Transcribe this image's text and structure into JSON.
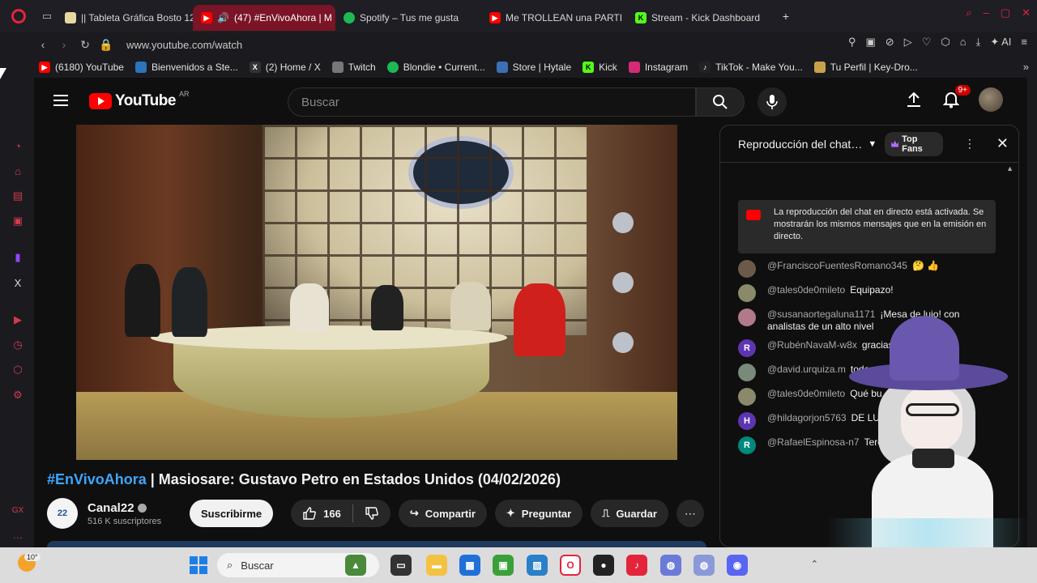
{
  "browser": {
    "tabs": [
      {
        "label": "|| Tableta Gráfica Bosto 12",
        "color": "#e6d8a0",
        "active": false
      },
      {
        "label": "(47) #EnVivoAhora | M",
        "color": "#ff0000",
        "active": true
      },
      {
        "label": "Spotify – Tus me gusta",
        "color": "#1db954",
        "active": false
      },
      {
        "label": "Me TROLLEAN una PARTI",
        "color": "#ff0000",
        "active": false
      },
      {
        "label": "Stream - Kick Dashboard",
        "color": "#53fc18",
        "active": false
      }
    ],
    "url": "www.youtube.com/watch",
    "bookmarks": [
      {
        "label": "(6180) YouTube",
        "color": "#ff0000"
      },
      {
        "label": "Bienvenidos a Ste...",
        "color": "#2a75bb"
      },
      {
        "label": "(2) Home / X",
        "color": "#333333"
      },
      {
        "label": "Twitch",
        "color": "#777777"
      },
      {
        "label": "Blondie • Current...",
        "color": "#1db954"
      },
      {
        "label": "Store | Hytale",
        "color": "#3c6fb5"
      },
      {
        "label": "Kick",
        "color": "#53fc18"
      },
      {
        "label": "Instagram",
        "color": "#d62976"
      },
      {
        "label": "TikTok - Make You...",
        "color": "#222222"
      },
      {
        "label": "Tu Perfil | Key-Dro...",
        "color": "#c7a24a"
      }
    ],
    "ai_label": "AI"
  },
  "youtube": {
    "wordmark": "YouTube",
    "country": "AR",
    "search_placeholder": "Buscar",
    "notifications": "9+",
    "video_title_hashtag": "#EnVivoAhora",
    "video_title_rest": " | Masiosare: Gustavo Petro en Estados Unidos (04/02/2026)",
    "channel_name": "Canal22",
    "subscribers": "516 K suscriptores",
    "subscribe_label": "Suscribirme",
    "likes": "166",
    "share_label": "Compartir",
    "ask_label": "Preguntar",
    "save_label": "Guardar"
  },
  "chat": {
    "title": "Reproducción del chat d...",
    "top_fans": "Top Fans",
    "notice": "La reproducción del chat en directo está activada. Se mostrarán los mismos mensajes que en la emisión en directo.",
    "messages": [
      {
        "author": "@FranciscoFuentesRomano345",
        "text": "🤔 👍",
        "avatar_color": "#6b5a4a",
        "initial": ""
      },
      {
        "author": "@tales0de0mileto",
        "text": "Equipazo!",
        "avatar_color": "#8a8a6a",
        "initial": ""
      },
      {
        "author": "@susanaortegaluna1171",
        "text": "¡Mesa de lujo! con analistas de un alto nivel",
        "avatar_color": "#b07a8a",
        "initial": ""
      },
      {
        "author": "@RubénNavaM-w8x",
        "text": "gracias",
        "avatar_color": "#5e35b1",
        "initial": "R"
      },
      {
        "author": "@david.urquiza.m",
        "text": "todos",
        "avatar_color": "#7a8a7a",
        "initial": ""
      },
      {
        "author": "@tales0de0mileto",
        "text": "Qué bu",
        "avatar_color": "#8a8a6a",
        "initial": ""
      },
      {
        "author": "@hildagorjon5763",
        "text": "DE LU",
        "avatar_color": "#5e35b1",
        "initial": "H"
      },
      {
        "author": "@RafaelEspinosa-n7",
        "text": "Tercera Temporada",
        "avatar_color": "#00897b",
        "initial": "R"
      }
    ]
  },
  "taskbar": {
    "weather_temp": "10°",
    "search_label": "Buscar"
  }
}
